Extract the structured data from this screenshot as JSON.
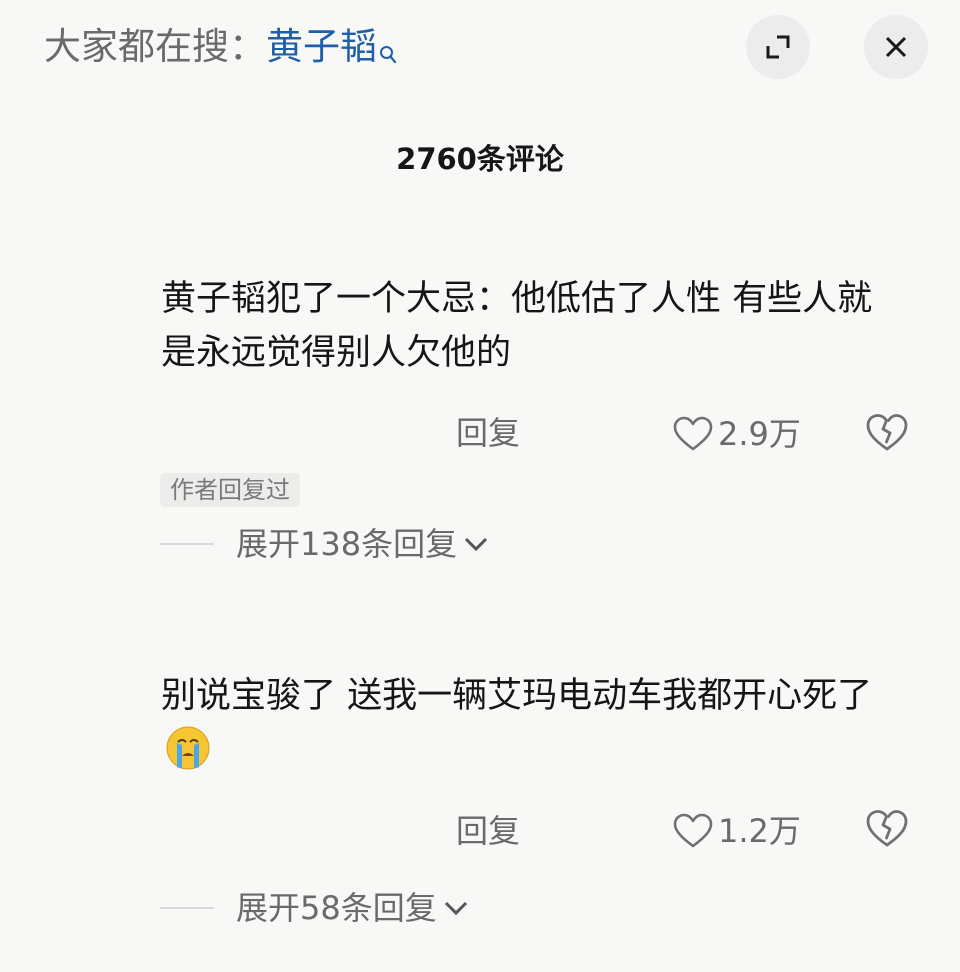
{
  "header": {
    "search_prefix": "大家都在搜：",
    "search_term": "黄子韬",
    "search_icon": "search-icon",
    "expand_icon": "expand-icon",
    "close_icon": "close-icon"
  },
  "comment_count": "2760条评论",
  "comments": [
    {
      "text": "黄子韬犯了一个大忌：他低估了人性 有些人就是永远觉得别人欠他的",
      "reply_label": "回复",
      "likes": "2.9万",
      "badge": "作者回复过",
      "expand_label": "展开138条回复"
    },
    {
      "text": "别说宝骏了  送我一辆艾玛电动车我都开心死了",
      "emoji": "crying-face-emoji",
      "reply_label": "回复",
      "likes": "1.2万",
      "expand_label": "展开58条回复"
    }
  ],
  "colors": {
    "background": "#f8f8f6",
    "search_term": "#1e5fa8",
    "secondary_text": "#6a6a6a",
    "button_bg": "#ececec"
  }
}
